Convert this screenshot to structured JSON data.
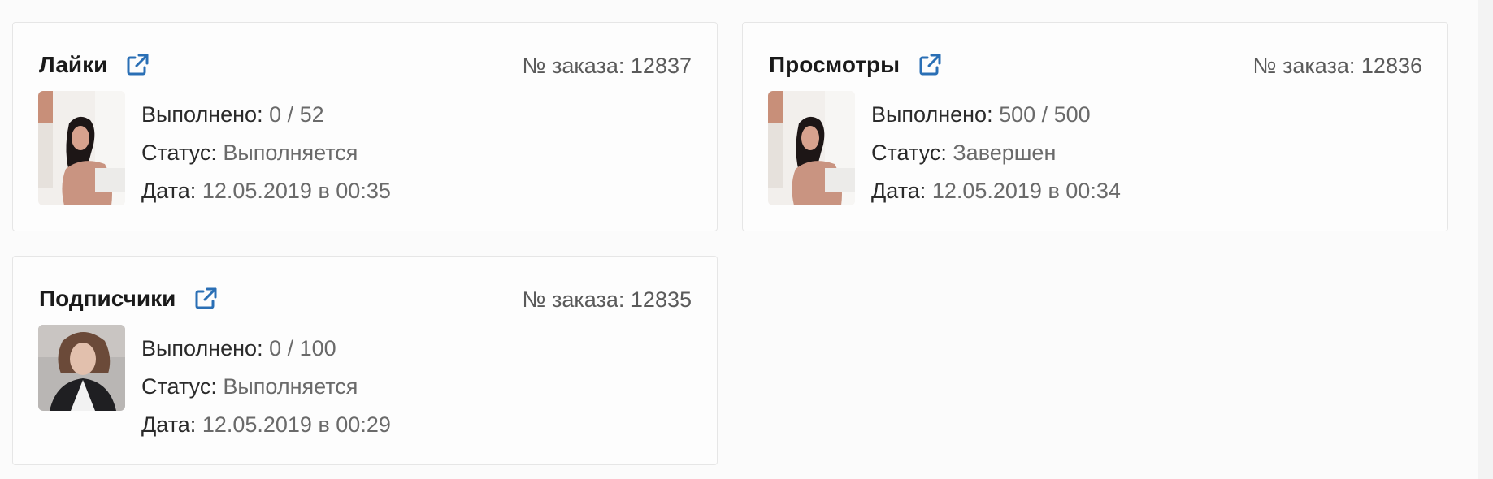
{
  "orders": [
    {
      "title": "Лайки",
      "order_label": "№ заказа:",
      "order_number": "12837",
      "done_label": "Выполнено:",
      "done_value": "0 / 52",
      "status_label": "Статус:",
      "status_value": "Выполняется",
      "date_label": "Дата:",
      "date_value": "12.05.2019 в 00:35",
      "icon": "external-link-icon"
    },
    {
      "title": "Просмотры",
      "order_label": "№ заказа:",
      "order_number": "12836",
      "done_label": "Выполнено:",
      "done_value": "500 / 500",
      "status_label": "Статус:",
      "status_value": "Завершен",
      "date_label": "Дата:",
      "date_value": "12.05.2019 в 00:34",
      "icon": "external-link-icon"
    },
    {
      "title": "Подписчики",
      "order_label": "№ заказа:",
      "order_number": "12835",
      "done_label": "Выполнено:",
      "done_value": "0 / 100",
      "status_label": "Статус:",
      "status_value": "Выполняется",
      "date_label": "Дата:",
      "date_value": "12.05.2019 в 00:29",
      "icon": "external-link-icon"
    }
  ],
  "colors": {
    "link_icon": "#2a6fb5",
    "label_text": "#2a2a2a",
    "value_text": "#6a6a6a",
    "card_border": "#e6e6e6"
  }
}
